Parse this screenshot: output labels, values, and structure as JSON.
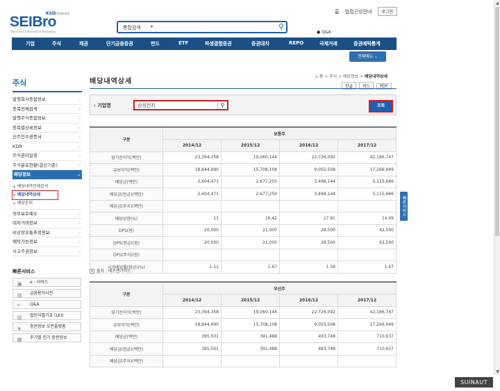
{
  "header": {
    "logo_brand": "SEIBro",
    "logo_ksd": "KSD",
    "logo_ksd_sub": "증권정보포털",
    "logo_tagline": "Securities Information Broadway",
    "search_category": "통합검색",
    "top_links": [
      "홈",
      "법접근성안내"
    ],
    "login_label": "로그인",
    "qna_label": "Q&A"
  },
  "gnb": [
    "기업",
    "주식",
    "채권",
    "단기금융증권",
    "펀드",
    "ETF",
    "파생결합증권",
    "증권대차",
    "REPO",
    "국제거래",
    "증권예탁통계"
  ],
  "all_menu_label": "전체메뉴 ⌄",
  "lnb": {
    "title": "주식",
    "items": [
      "발행회사종합정보",
      "종목전체검색",
      "발행주식종합정보",
      "종목별상세정보",
      "신주인수권증서",
      "KDR",
      "주식권리일정",
      "주식분포현황(결산기준)"
    ],
    "selected": "배당정보",
    "sub_items": [
      "배당내역전체검색",
      "배당내역상세",
      "배당순위"
    ],
    "selected_sub": "배당내역상세",
    "items_after": [
      "의무보호예수",
      "대차거래정보",
      "비상장유통추정정보",
      "예탁가능정보",
      "사고주권정보"
    ]
  },
  "quick": {
    "title": "빠른서비스",
    "items": [
      "e - 서비스",
      "금융용어사전",
      "Q&A",
      "법인식별기호 (LEI)",
      "증권정보 오픈플랫폼",
      "주기별 인기 증권정보"
    ]
  },
  "page": {
    "title": "배당내역상세",
    "breadcrumb": [
      "홈",
      "주식",
      "배당정보",
      "배당내역상세"
    ],
    "actions": [
      "한글",
      "워드",
      "PDF"
    ]
  },
  "search": {
    "label": "기업명",
    "value": "삼성전자",
    "submit": "조회"
  },
  "table_common": {
    "col_label": "구분",
    "years": [
      "2014/12",
      "2015/12",
      "2016/12",
      "2017/12"
    ]
  },
  "common_stock": {
    "header": "보통주",
    "rows": [
      {
        "label": "당기순이익(백만)",
        "values": [
          "23,394,358",
          "19,060,144",
          "22,726,092",
          "42,186,747"
        ]
      },
      {
        "label": "유보이익(백만)",
        "values": [
          "18,844,990",
          "15,708,108",
          "9,055,508",
          "17,266,949"
        ]
      },
      {
        "label": "배당금(백만)",
        "values": [
          "2,604,471",
          "2,677,250",
          "3,498,144",
          "5,115,666"
        ]
      },
      {
        "label": "배당금(현금)(백만)",
        "values": [
          "2,604,471",
          "2,677,250",
          "3,498,144",
          "5,115,666"
        ]
      },
      {
        "label": "배당금(주식)(백만)",
        "values": [
          "",
          "",
          "",
          ""
        ]
      },
      {
        "label": "배당성향(%)",
        "values": [
          "13",
          "16.42",
          "17.81",
          "14.09"
        ]
      },
      {
        "label": "DPS(원)",
        "values": [
          "20,000",
          "21,000",
          "28,500",
          "42,500"
        ]
      },
      {
        "label": "DPS(현금)(원)",
        "values": [
          "20,000",
          "21,000",
          "28,500",
          "42,500"
        ]
      },
      {
        "label": "DPS(주식)(원)",
        "values": [
          "",
          "",
          "",
          ""
        ]
      },
      {
        "label": "시가배당률(현금)(%)",
        "values": [
          "1.51",
          "1.67",
          "1.58",
          "1.67"
        ]
      }
    ]
  },
  "source": "출처 : 에프앤가이드",
  "preferred_stock": {
    "header": "우선주",
    "rows": [
      {
        "label": "당기순이익(백만)",
        "values": [
          "23,394,358",
          "19,060,144",
          "22,726,092",
          "42,186,747"
        ]
      },
      {
        "label": "유보이익(백만)",
        "values": [
          "18,844,990",
          "15,708,108",
          "9,055,508",
          "17,266,949"
        ]
      },
      {
        "label": "배당금(백만)",
        "values": [
          "395,501",
          "391,488",
          "493,748",
          "710,637"
        ]
      },
      {
        "label": "배당금(현금)(백만)",
        "values": [
          "395,501",
          "391,488",
          "493,748",
          "710,637"
        ]
      },
      {
        "label": "배당금(주식)(백만)",
        "values": [
          "",
          "",
          "",
          ""
        ]
      }
    ]
  },
  "side_tab": "빠른서비스",
  "bottom_badge": "SUINAUT"
}
